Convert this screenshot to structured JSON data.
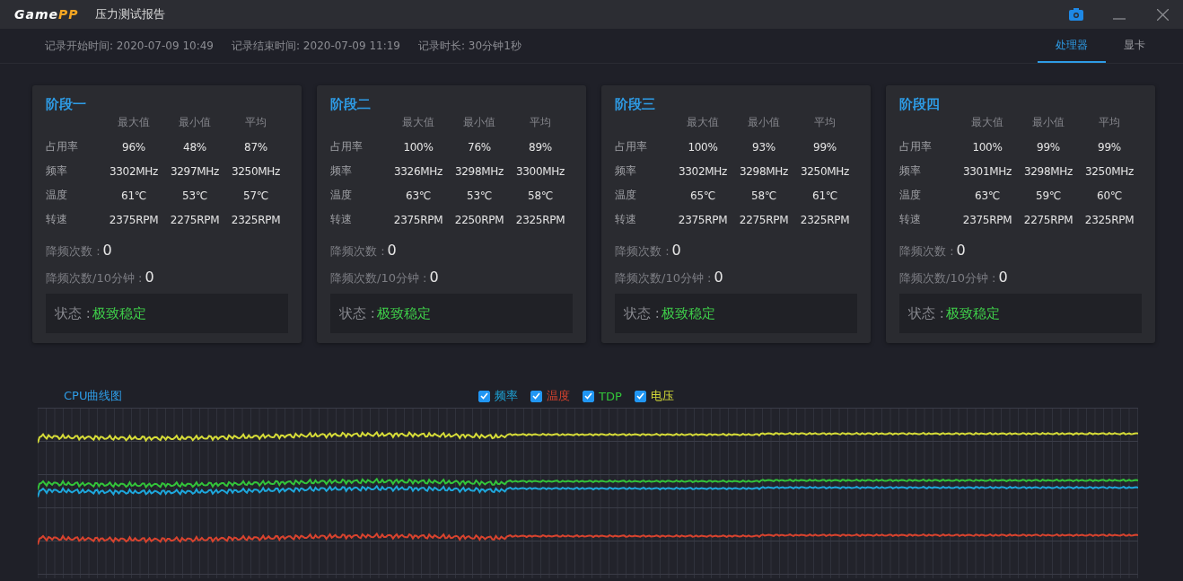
{
  "app": {
    "logo": {
      "part_1": "Game",
      "part_2": "PP"
    },
    "title": "压力测试报告"
  },
  "record": [
    "记录开始时间: 2020-07-09 10:49",
    "记录结束时间: 2020-07-09 11:19",
    "记录时长: 30分钟1秒"
  ],
  "tabs": [
    {
      "label": "处理器",
      "selected": true
    },
    {
      "label": "显卡",
      "selected": false
    }
  ],
  "stages": [
    {
      "title": "阶段一",
      "columns": [
        "最大值",
        "最小值",
        "平均"
      ],
      "rows": [
        {
          "label": "占用率",
          "values": [
            "96%",
            "48%",
            "87%"
          ]
        },
        {
          "label": "频率",
          "values": [
            "3302MHz",
            "3297MHz",
            "3250MHz"
          ]
        },
        {
          "label": "温度",
          "values": [
            "61℃",
            "53℃",
            "57℃"
          ]
        },
        {
          "label": "转速",
          "values": [
            "2375RPM",
            "2275RPM",
            "2325RPM"
          ]
        }
      ],
      "throttle": [
        {
          "label": "降频次数 :",
          "value": "0"
        },
        {
          "label": "降频次数/10分钟 :",
          "value": "0"
        }
      ],
      "status": {
        "label": "状态 :",
        "value": "极致稳定"
      }
    },
    {
      "title": "阶段二",
      "columns": [
        "最大值",
        "最小值",
        "平均"
      ],
      "rows": [
        {
          "label": "占用率",
          "values": [
            "100%",
            "76%",
            "89%"
          ]
        },
        {
          "label": "频率",
          "values": [
            "3326MHz",
            "3298MHz",
            "3300MHz"
          ]
        },
        {
          "label": "温度",
          "values": [
            "63℃",
            "53℃",
            "58℃"
          ]
        },
        {
          "label": "转速",
          "values": [
            "2375RPM",
            "2250RPM",
            "2325RPM"
          ]
        }
      ],
      "throttle": [
        {
          "label": "降频次数 :",
          "value": "0"
        },
        {
          "label": "降频次数/10分钟 :",
          "value": "0"
        }
      ],
      "status": {
        "label": "状态 :",
        "value": "极致稳定"
      }
    },
    {
      "title": "阶段三",
      "columns": [
        "最大值",
        "最小值",
        "平均"
      ],
      "rows": [
        {
          "label": "占用率",
          "values": [
            "100%",
            "93%",
            "99%"
          ]
        },
        {
          "label": "频率",
          "values": [
            "3302MHz",
            "3298MHz",
            "3250MHz"
          ]
        },
        {
          "label": "温度",
          "values": [
            "65℃",
            "58℃",
            "61℃"
          ]
        },
        {
          "label": "转速",
          "values": [
            "2375RPM",
            "2275RPM",
            "2325RPM"
          ]
        }
      ],
      "throttle": [
        {
          "label": "降频次数 :",
          "value": "0"
        },
        {
          "label": "降频次数/10分钟 :",
          "value": "0"
        }
      ],
      "status": {
        "label": "状态 :",
        "value": "极致稳定"
      }
    },
    {
      "title": "阶段四",
      "columns": [
        "最大值",
        "最小值",
        "平均"
      ],
      "rows": [
        {
          "label": "占用率",
          "values": [
            "100%",
            "99%",
            "99%"
          ]
        },
        {
          "label": "频率",
          "values": [
            "3301MHz",
            "3298MHz",
            "3250MHz"
          ]
        },
        {
          "label": "温度",
          "values": [
            "63℃",
            "59℃",
            "60℃"
          ]
        },
        {
          "label": "转速",
          "values": [
            "2375RPM",
            "2275RPM",
            "2325RPM"
          ]
        }
      ],
      "throttle": [
        {
          "label": "降频次数 :",
          "value": "0"
        },
        {
          "label": "降频次数/10分钟 :",
          "value": "0"
        }
      ],
      "status": {
        "label": "状态 :",
        "value": "极致稳定"
      }
    }
  ],
  "chart": {
    "title": "CPU曲线图",
    "legend": [
      {
        "label": "频率",
        "checked": true,
        "color": "#1ea7dc"
      },
      {
        "label": "温度",
        "checked": true,
        "color": "#d8432e"
      },
      {
        "label": "TDP",
        "checked": true,
        "color": "#33c43a"
      },
      {
        "label": "电压",
        "checked": true,
        "color": "#d6dc38"
      }
    ]
  }
}
